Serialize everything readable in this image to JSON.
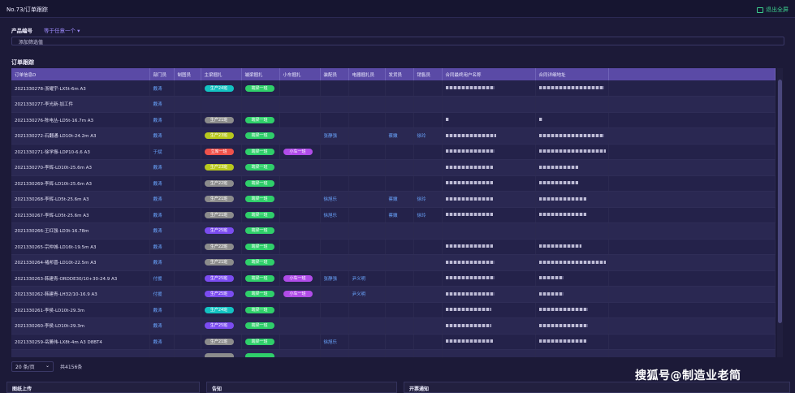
{
  "window": {
    "title": "No.73/订单跟踪",
    "exit_label": "退出全屏"
  },
  "filter": {
    "label": "产品编号",
    "select_placeholder": "等于任意一个 ▾",
    "add_label": "添加筛选值"
  },
  "section_title": "订单跟踪",
  "table": {
    "columns": [
      "订单信息D",
      "部门员",
      "制图员",
      "主梁捆扎",
      "端梁捆扎",
      "小车捆扎",
      "装配员",
      "电器捆扎员",
      "发货员",
      "销售员",
      "合同最终用户名称",
      "合同详细地址"
    ],
    "rows": [
      {
        "order": "2021330278-浙耀宇-LX5t-6m A3",
        "dept": "戴涛",
        "draw": "",
        "main": {
          "text": "生产24班",
          "color": "#13c2c2"
        },
        "end": {
          "text": "端梁一班",
          "color": "#2fcf6a"
        },
        "car": null,
        "asm": "",
        "elec": "",
        "ship": "",
        "sales": "",
        "r1": 60,
        "r2": 80
      },
      {
        "order": "2021330277-李光新-加工件",
        "dept": "戴涛",
        "draw": "",
        "main": null,
        "end": null,
        "car": null,
        "asm": "",
        "elec": "",
        "ship": "",
        "sales": "",
        "r1": 0,
        "r2": 0
      },
      {
        "order": "2021330276-陈电丛-LD5t-16.7m A3",
        "dept": "戴涛",
        "draw": "",
        "main": {
          "text": "生产21班",
          "color": "#8c8c8c"
        },
        "end": {
          "text": "端梁一班",
          "color": "#2fcf6a"
        },
        "car": null,
        "asm": "",
        "elec": "",
        "ship": "",
        "sales": "",
        "r1": 4,
        "r2": 4
      },
      {
        "order": "2021330272-石翻通-LD10t-24.2m A3",
        "dept": "戴涛",
        "draw": "",
        "main": {
          "text": "生产23班",
          "color": "#b8c81e"
        },
        "end": {
          "text": "端梁一班",
          "color": "#2fcf6a"
        },
        "car": null,
        "asm": "张静强",
        "elec": "",
        "ship": "蔡嫩",
        "sales": "徐玲",
        "r1": 62,
        "r2": 80
      },
      {
        "order": "2021330271-徐学振-LDP10-6.6 A3",
        "dept": "于斌",
        "draw": "",
        "main": {
          "text": "立库一班",
          "color": "#f0524b"
        },
        "end": {
          "text": "端梁一班",
          "color": "#2fcf6a"
        },
        "car": {
          "text": "小车一班",
          "color": "#b04ce8"
        },
        "asm": "",
        "elec": "",
        "ship": "",
        "sales": "",
        "r1": 60,
        "r2": 82
      },
      {
        "order": "2021330270-李辉-LD10t-25.6m A3",
        "dept": "戴涛",
        "draw": "",
        "main": {
          "text": "生产23班",
          "color": "#b8c81e"
        },
        "end": {
          "text": "端梁一班",
          "color": "#2fcf6a"
        },
        "car": null,
        "asm": "",
        "elec": "",
        "ship": "",
        "sales": "",
        "r1": 58,
        "r2": 48
      },
      {
        "order": "2021330269-李辉-LD10t-25.6m A3",
        "dept": "戴涛",
        "draw": "",
        "main": {
          "text": "生产22班",
          "color": "#8c8c8c"
        },
        "end": {
          "text": "端梁一班",
          "color": "#2fcf6a"
        },
        "car": null,
        "asm": "",
        "elec": "",
        "ship": "",
        "sales": "",
        "r1": 58,
        "r2": 48
      },
      {
        "order": "2021330268-李辉-LD5t-25.6m A3",
        "dept": "戴涛",
        "draw": "",
        "main": {
          "text": "生产21班",
          "color": "#8c8c8c"
        },
        "end": {
          "text": "端梁一班",
          "color": "#2fcf6a"
        },
        "car": null,
        "asm": "徐旭乐",
        "elec": "",
        "ship": "蔡嫩",
        "sales": "徐玲",
        "r1": 58,
        "r2": 58
      },
      {
        "order": "2021330267-李辉-LD5t-25.6m A3",
        "dept": "戴涛",
        "draw": "",
        "main": {
          "text": "生产21班",
          "color": "#8c8c8c"
        },
        "end": {
          "text": "端梁一班",
          "color": "#2fcf6a"
        },
        "car": null,
        "asm": "徐旭乐",
        "elec": "",
        "ship": "蔡嫩",
        "sales": "徐玲",
        "r1": 58,
        "r2": 58
      },
      {
        "order": "2021330266-王红强-LD3t-16.78m",
        "dept": "戴涛",
        "draw": "",
        "main": {
          "text": "生产25班",
          "color": "#7b4cf0"
        },
        "end": {
          "text": "端梁一班",
          "color": "#2fcf6a"
        },
        "car": null,
        "asm": "",
        "elec": "",
        "ship": "",
        "sales": "",
        "r1": 0,
        "r2": 0
      },
      {
        "order": "2021330265-宗仲城-LD16t-19.5m A3",
        "dept": "戴涛",
        "draw": "",
        "main": {
          "text": "生产22班",
          "color": "#8c8c8c"
        },
        "end": {
          "text": "端梁一班",
          "color": "#2fcf6a"
        },
        "car": null,
        "asm": "",
        "elec": "",
        "ship": "",
        "sales": "",
        "r1": 58,
        "r2": 52
      },
      {
        "order": "2021330264-褚邦晋-LD10t-22.5m A3",
        "dept": "戴涛",
        "draw": "",
        "main": {
          "text": "生产21班",
          "color": "#8c8c8c"
        },
        "end": {
          "text": "端梁一班",
          "color": "#2fcf6a"
        },
        "car": null,
        "asm": "",
        "elec": "",
        "ship": "",
        "sales": "",
        "r1": 60,
        "r2": 82
      },
      {
        "order": "2021330263-韩建青-ORDDE30/10+30-24.9 A3",
        "dept": "付援",
        "draw": "",
        "main": {
          "text": "生产25班",
          "color": "#7b4cf0"
        },
        "end": {
          "text": "端梁一班",
          "color": "#2fcf6a"
        },
        "car": {
          "text": "小车一班",
          "color": "#b04ce8"
        },
        "asm": "张静强",
        "elec": "尹义明",
        "ship": "",
        "sales": "",
        "r1": 60,
        "r2": 30
      },
      {
        "order": "2021330262-韩建青-LH32/10-16.9 A3",
        "dept": "付援",
        "draw": "",
        "main": {
          "text": "生产25班",
          "color": "#7b4cf0"
        },
        "end": {
          "text": "端梁一班",
          "color": "#2fcf6a"
        },
        "car": {
          "text": "小车一班",
          "color": "#b04ce8"
        },
        "asm": "",
        "elec": "尹义明",
        "ship": "",
        "sales": "",
        "r1": 60,
        "r2": 30
      },
      {
        "order": "2021330261-李侯-LD10t-29.3m",
        "dept": "戴涛",
        "draw": "",
        "main": {
          "text": "生产24班",
          "color": "#13c2c2"
        },
        "end": {
          "text": "端梁一班",
          "color": "#2fcf6a"
        },
        "car": null,
        "asm": "",
        "elec": "",
        "ship": "",
        "sales": "",
        "r1": 56,
        "r2": 60
      },
      {
        "order": "2021330260-李侯-LD10t-29.3m",
        "dept": "戴涛",
        "draw": "",
        "main": {
          "text": "生产25班",
          "color": "#7b4cf0"
        },
        "end": {
          "text": "端梁一班",
          "color": "#2fcf6a"
        },
        "car": null,
        "asm": "",
        "elec": "",
        "ship": "",
        "sales": "",
        "r1": 56,
        "r2": 60
      },
      {
        "order": "2021330259-岳勝伟-LX8t-4m A3 D8BT4",
        "dept": "戴涛",
        "draw": "",
        "main": {
          "text": "生产21班",
          "color": "#8c8c8c"
        },
        "end": {
          "text": "端梁一班",
          "color": "#2fcf6a"
        },
        "car": null,
        "asm": "徐旭乐",
        "elec": "",
        "ship": "",
        "sales": "",
        "r1": 58,
        "r2": 58
      },
      {
        "order": "",
        "dept": "",
        "draw": "",
        "main": {
          "text": "",
          "color": "#8c8c8c"
        },
        "end": {
          "text": "",
          "color": "#2fcf6a"
        },
        "car": null,
        "asm": "",
        "elec": "",
        "ship": "",
        "sales": "",
        "r1": 0,
        "r2": 0
      }
    ]
  },
  "pager": {
    "page_size": "20 条/页",
    "total": "共4156条"
  },
  "panels": [
    "图纸上传",
    "告知",
    "开票通知"
  ],
  "watermark": "搜狐号@制造业老简"
}
